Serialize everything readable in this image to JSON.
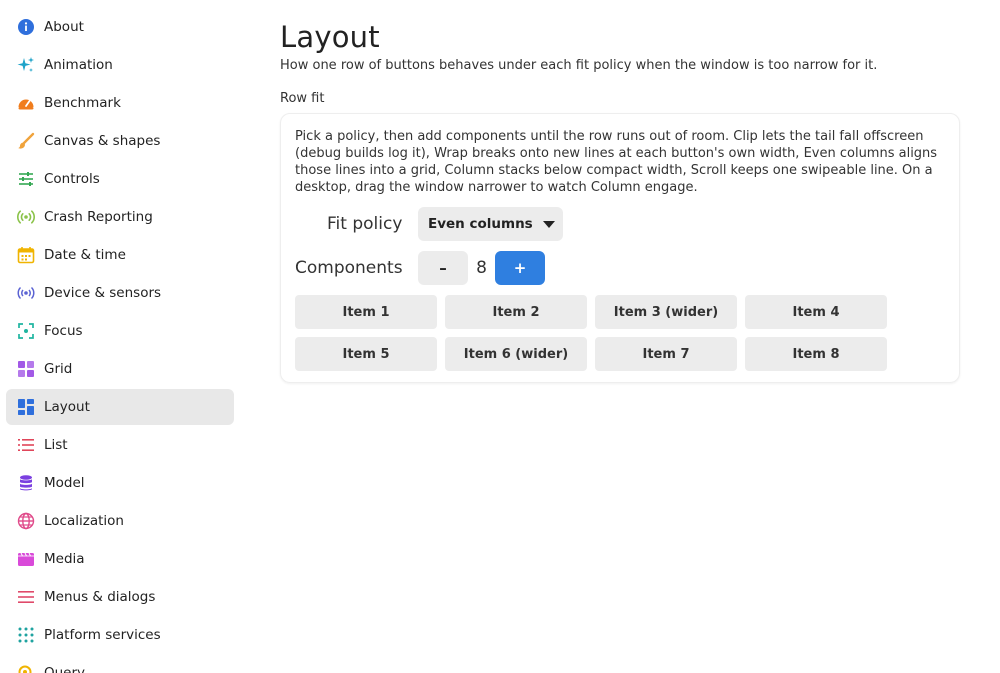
{
  "sidebar": {
    "items": [
      {
        "label": "About",
        "icon": "info-icon",
        "color": "#2f6fdc"
      },
      {
        "label": "Animation",
        "icon": "sparkles-icon",
        "color": "#1fa3c9"
      },
      {
        "label": "Benchmark",
        "icon": "speedometer-icon",
        "color": "#f07d1d"
      },
      {
        "label": "Canvas & shapes",
        "icon": "brush-icon",
        "color": "#f0a33c"
      },
      {
        "label": "Controls",
        "icon": "sliders-icon",
        "color": "#34a853"
      },
      {
        "label": "Crash Reporting",
        "icon": "signal-icon",
        "color": "#8bc34a"
      },
      {
        "label": "Date & time",
        "icon": "calendar-icon",
        "color": "#f0b400"
      },
      {
        "label": "Device & sensors",
        "icon": "broadcast-icon",
        "color": "#5b63d3"
      },
      {
        "label": "Focus",
        "icon": "focus-icon",
        "color": "#1fb5a0"
      },
      {
        "label": "Grid",
        "icon": "grid-icon",
        "color": "#a259e6"
      },
      {
        "label": "Layout",
        "icon": "layout-icon",
        "color": "#2f6fdc",
        "active": true
      },
      {
        "label": "List",
        "icon": "list-icon",
        "color": "#e0465a"
      },
      {
        "label": "Model",
        "icon": "database-icon",
        "color": "#7b3fe0"
      },
      {
        "label": "Localization",
        "icon": "globe-icon",
        "color": "#e04a8a"
      },
      {
        "label": "Media",
        "icon": "film-icon",
        "color": "#d94ad9"
      },
      {
        "label": "Menus & dialogs",
        "icon": "menu-icon",
        "color": "#e04a6a"
      },
      {
        "label": "Platform services",
        "icon": "dots-grid-icon",
        "color": "#1fa3a0"
      },
      {
        "label": "Query",
        "icon": "search-icon",
        "color": "#f0b400"
      }
    ]
  },
  "main": {
    "title": "Layout",
    "subtitle": "How one row of buttons behaves under each fit policy when the window is too narrow for it.",
    "section_label": "Row fit",
    "card": {
      "description": "Pick a policy, then add components until the row runs out of room. Clip lets the tail fall offscreen (debug builds log it), Wrap breaks onto new lines at each button's own width, Even columns aligns those lines into a grid, Column stacks below compact width, Scroll keeps one swipeable line. On a desktop, drag the window narrower to watch Column engage.",
      "fit_policy_label": "Fit policy",
      "fit_policy_value": "Even columns",
      "components_label": "Components",
      "minus_label": "–",
      "plus_label": "+",
      "components_count": "8",
      "items": [
        "Item 1",
        "Item 2",
        "Item 3 (wider)",
        "Item 4",
        "Item 5",
        "Item 6 (wider)",
        "Item 7",
        "Item 8"
      ]
    }
  },
  "colors": {
    "accent": "#2f7fe0",
    "active_nav_bg": "#e8e8e8",
    "button_bg": "#ececec"
  }
}
